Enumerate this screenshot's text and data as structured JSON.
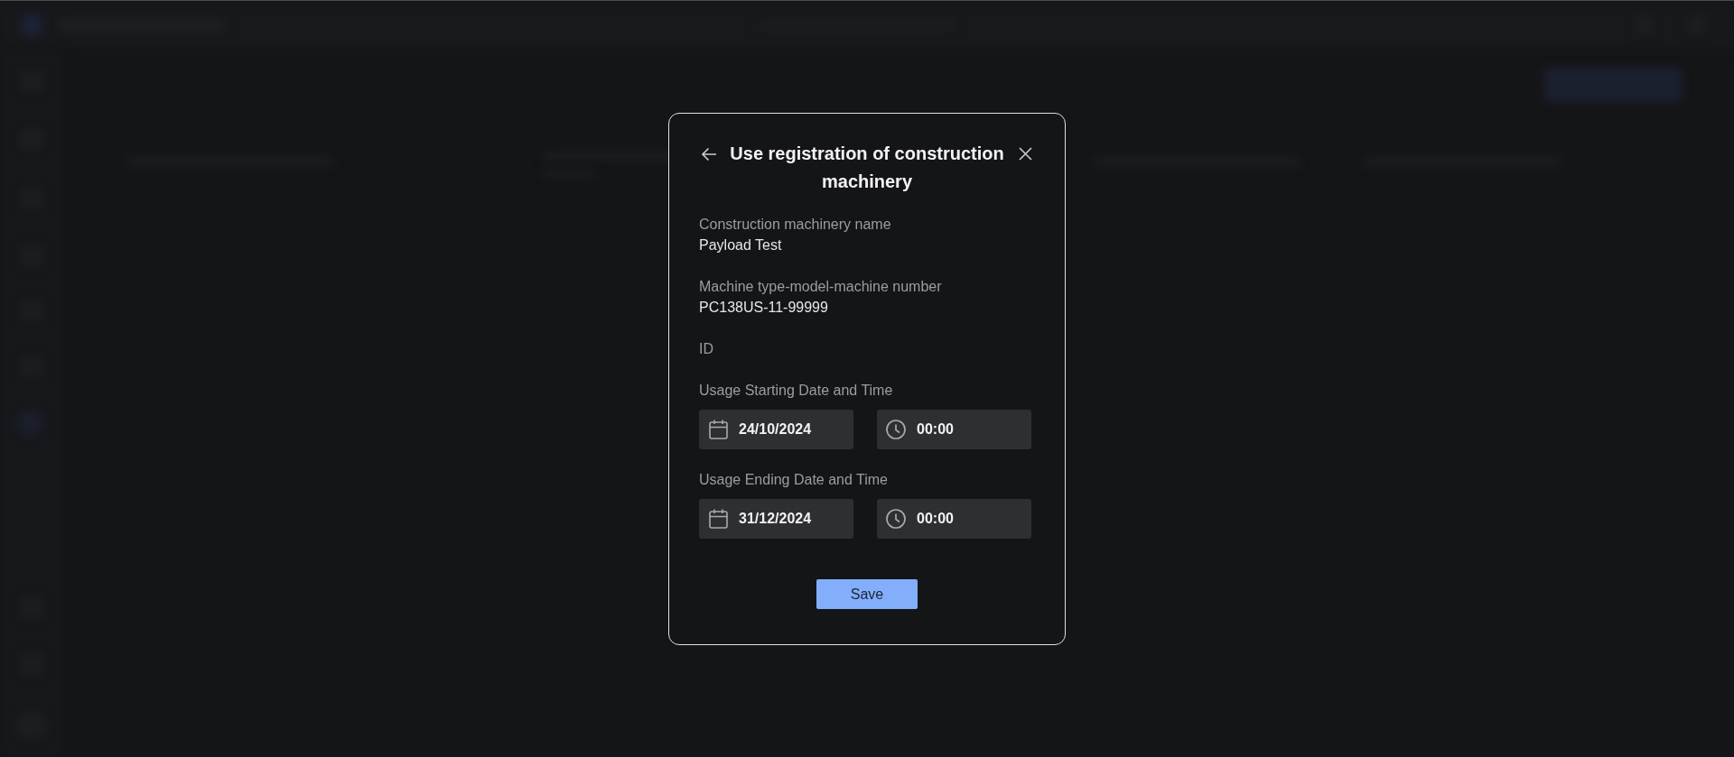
{
  "dialog": {
    "title": "Use registration of construction machinery",
    "fields": [
      {
        "label": "Construction machinery name",
        "value": "Payload Test"
      },
      {
        "label": "Machine type-model-machine number",
        "value": "PC138US-11-99999"
      },
      {
        "label": "ID"
      }
    ],
    "periods": [
      {
        "label": "Usage Starting Date and Time",
        "date": "24/10/2024",
        "time": "00:00"
      },
      {
        "label": "Usage Ending Date and Time",
        "date": "31/12/2024",
        "time": "00:00"
      }
    ],
    "save_button": {
      "label": "Save"
    }
  }
}
